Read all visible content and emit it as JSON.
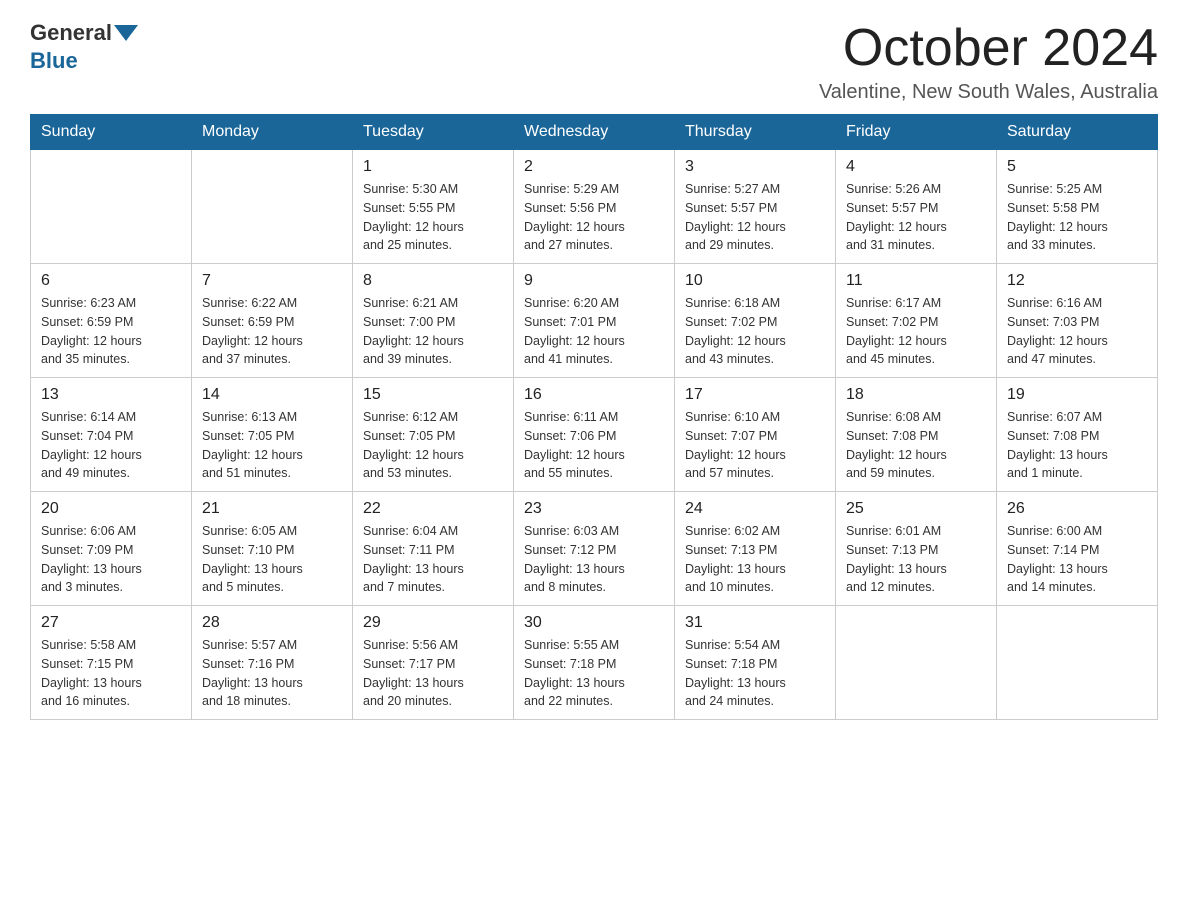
{
  "header": {
    "logo_general": "General",
    "logo_blue": "Blue",
    "month_title": "October 2024",
    "location": "Valentine, New South Wales, Australia"
  },
  "weekdays": [
    "Sunday",
    "Monday",
    "Tuesday",
    "Wednesday",
    "Thursday",
    "Friday",
    "Saturday"
  ],
  "weeks": [
    [
      {
        "day": "",
        "info": ""
      },
      {
        "day": "",
        "info": ""
      },
      {
        "day": "1",
        "info": "Sunrise: 5:30 AM\nSunset: 5:55 PM\nDaylight: 12 hours\nand 25 minutes."
      },
      {
        "day": "2",
        "info": "Sunrise: 5:29 AM\nSunset: 5:56 PM\nDaylight: 12 hours\nand 27 minutes."
      },
      {
        "day": "3",
        "info": "Sunrise: 5:27 AM\nSunset: 5:57 PM\nDaylight: 12 hours\nand 29 minutes."
      },
      {
        "day": "4",
        "info": "Sunrise: 5:26 AM\nSunset: 5:57 PM\nDaylight: 12 hours\nand 31 minutes."
      },
      {
        "day": "5",
        "info": "Sunrise: 5:25 AM\nSunset: 5:58 PM\nDaylight: 12 hours\nand 33 minutes."
      }
    ],
    [
      {
        "day": "6",
        "info": "Sunrise: 6:23 AM\nSunset: 6:59 PM\nDaylight: 12 hours\nand 35 minutes."
      },
      {
        "day": "7",
        "info": "Sunrise: 6:22 AM\nSunset: 6:59 PM\nDaylight: 12 hours\nand 37 minutes."
      },
      {
        "day": "8",
        "info": "Sunrise: 6:21 AM\nSunset: 7:00 PM\nDaylight: 12 hours\nand 39 minutes."
      },
      {
        "day": "9",
        "info": "Sunrise: 6:20 AM\nSunset: 7:01 PM\nDaylight: 12 hours\nand 41 minutes."
      },
      {
        "day": "10",
        "info": "Sunrise: 6:18 AM\nSunset: 7:02 PM\nDaylight: 12 hours\nand 43 minutes."
      },
      {
        "day": "11",
        "info": "Sunrise: 6:17 AM\nSunset: 7:02 PM\nDaylight: 12 hours\nand 45 minutes."
      },
      {
        "day": "12",
        "info": "Sunrise: 6:16 AM\nSunset: 7:03 PM\nDaylight: 12 hours\nand 47 minutes."
      }
    ],
    [
      {
        "day": "13",
        "info": "Sunrise: 6:14 AM\nSunset: 7:04 PM\nDaylight: 12 hours\nand 49 minutes."
      },
      {
        "day": "14",
        "info": "Sunrise: 6:13 AM\nSunset: 7:05 PM\nDaylight: 12 hours\nand 51 minutes."
      },
      {
        "day": "15",
        "info": "Sunrise: 6:12 AM\nSunset: 7:05 PM\nDaylight: 12 hours\nand 53 minutes."
      },
      {
        "day": "16",
        "info": "Sunrise: 6:11 AM\nSunset: 7:06 PM\nDaylight: 12 hours\nand 55 minutes."
      },
      {
        "day": "17",
        "info": "Sunrise: 6:10 AM\nSunset: 7:07 PM\nDaylight: 12 hours\nand 57 minutes."
      },
      {
        "day": "18",
        "info": "Sunrise: 6:08 AM\nSunset: 7:08 PM\nDaylight: 12 hours\nand 59 minutes."
      },
      {
        "day": "19",
        "info": "Sunrise: 6:07 AM\nSunset: 7:08 PM\nDaylight: 13 hours\nand 1 minute."
      }
    ],
    [
      {
        "day": "20",
        "info": "Sunrise: 6:06 AM\nSunset: 7:09 PM\nDaylight: 13 hours\nand 3 minutes."
      },
      {
        "day": "21",
        "info": "Sunrise: 6:05 AM\nSunset: 7:10 PM\nDaylight: 13 hours\nand 5 minutes."
      },
      {
        "day": "22",
        "info": "Sunrise: 6:04 AM\nSunset: 7:11 PM\nDaylight: 13 hours\nand 7 minutes."
      },
      {
        "day": "23",
        "info": "Sunrise: 6:03 AM\nSunset: 7:12 PM\nDaylight: 13 hours\nand 8 minutes."
      },
      {
        "day": "24",
        "info": "Sunrise: 6:02 AM\nSunset: 7:13 PM\nDaylight: 13 hours\nand 10 minutes."
      },
      {
        "day": "25",
        "info": "Sunrise: 6:01 AM\nSunset: 7:13 PM\nDaylight: 13 hours\nand 12 minutes."
      },
      {
        "day": "26",
        "info": "Sunrise: 6:00 AM\nSunset: 7:14 PM\nDaylight: 13 hours\nand 14 minutes."
      }
    ],
    [
      {
        "day": "27",
        "info": "Sunrise: 5:58 AM\nSunset: 7:15 PM\nDaylight: 13 hours\nand 16 minutes."
      },
      {
        "day": "28",
        "info": "Sunrise: 5:57 AM\nSunset: 7:16 PM\nDaylight: 13 hours\nand 18 minutes."
      },
      {
        "day": "29",
        "info": "Sunrise: 5:56 AM\nSunset: 7:17 PM\nDaylight: 13 hours\nand 20 minutes."
      },
      {
        "day": "30",
        "info": "Sunrise: 5:55 AM\nSunset: 7:18 PM\nDaylight: 13 hours\nand 22 minutes."
      },
      {
        "day": "31",
        "info": "Sunrise: 5:54 AM\nSunset: 7:18 PM\nDaylight: 13 hours\nand 24 minutes."
      },
      {
        "day": "",
        "info": ""
      },
      {
        "day": "",
        "info": ""
      }
    ]
  ]
}
